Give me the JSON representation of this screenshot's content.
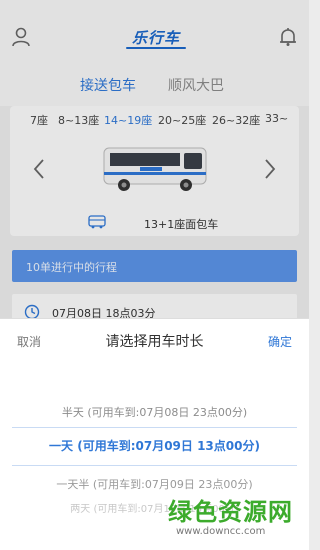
{
  "header": {
    "logo_text": "乐行车",
    "user_icon": "user-icon",
    "bell_icon": "bell-icon"
  },
  "mode_tabs": [
    {
      "label": "接送包车",
      "active": true
    },
    {
      "label": "顺风大巴",
      "active": false
    }
  ],
  "seat_options": [
    {
      "label": "7座",
      "selected": false
    },
    {
      "label": "8~13座",
      "selected": false
    },
    {
      "label": "14~19座",
      "selected": true
    },
    {
      "label": "20~25座",
      "selected": false
    },
    {
      "label": "26~32座",
      "selected": false
    },
    {
      "label": "33~",
      "selected": false
    }
  ],
  "vehicle": {
    "name": "13+1座面包车"
  },
  "trips": {
    "label": "10单进行中的行程",
    "first_time": "07月08日 18点03分"
  },
  "picker": {
    "cancel_label": "取消",
    "title": "请选择用车时长",
    "confirm_label": "确定",
    "options": [
      "半天 (可用车到:07月08日 23点00分)",
      "一天 (可用车到:07月09日 13点00分)",
      "一天半 (可用车到:07月09日 23点00分)",
      "两天 (可用车到:07月10日 13点00分)"
    ],
    "selected_index": 1
  },
  "watermark": {
    "text": "绿色资源网",
    "url": "www.downcc.com"
  },
  "colors": {
    "accent": "#2f77d6",
    "trips_bar": "#5b93e6",
    "watermark_green": "#3cab2c"
  }
}
